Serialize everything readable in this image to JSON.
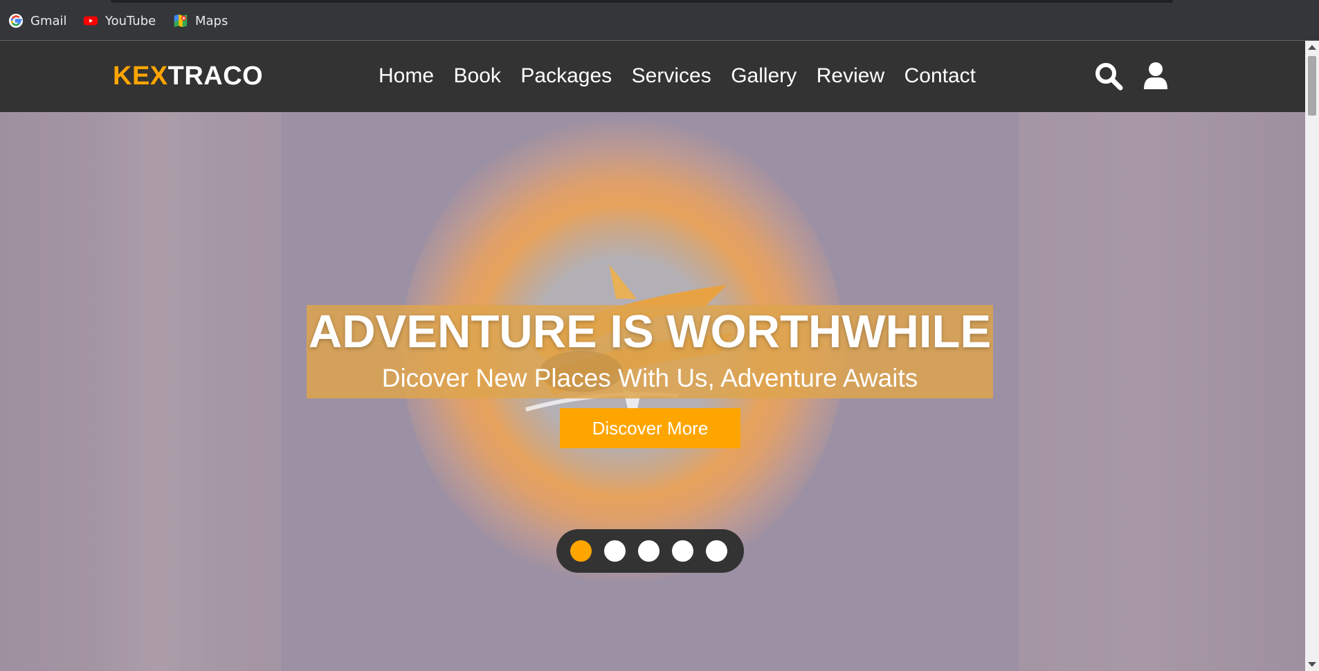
{
  "bookmarks": [
    {
      "label": "Gmail",
      "icon": "google-icon"
    },
    {
      "label": "YouTube",
      "icon": "youtube-icon"
    },
    {
      "label": "Maps",
      "icon": "maps-icon"
    }
  ],
  "header": {
    "logo_part1": "KEX",
    "logo_part2": "TRACO",
    "nav": [
      "Home",
      "Book",
      "Packages",
      "Services",
      "Gallery",
      "Review",
      "Contact"
    ],
    "icons": [
      "search-icon",
      "user-icon"
    ]
  },
  "hero": {
    "title": "ADVENTURE IS WORTHWHILE",
    "subtitle": "Dicover New Places With Us, Adventure Awaits",
    "cta_label": "Discover More",
    "slides_total": 5,
    "active_slide": 1
  },
  "colors": {
    "accent": "#ffa500",
    "header_bg": "#333333",
    "hero_bg": "#9e91a3",
    "browser_chrome": "#35363a"
  }
}
